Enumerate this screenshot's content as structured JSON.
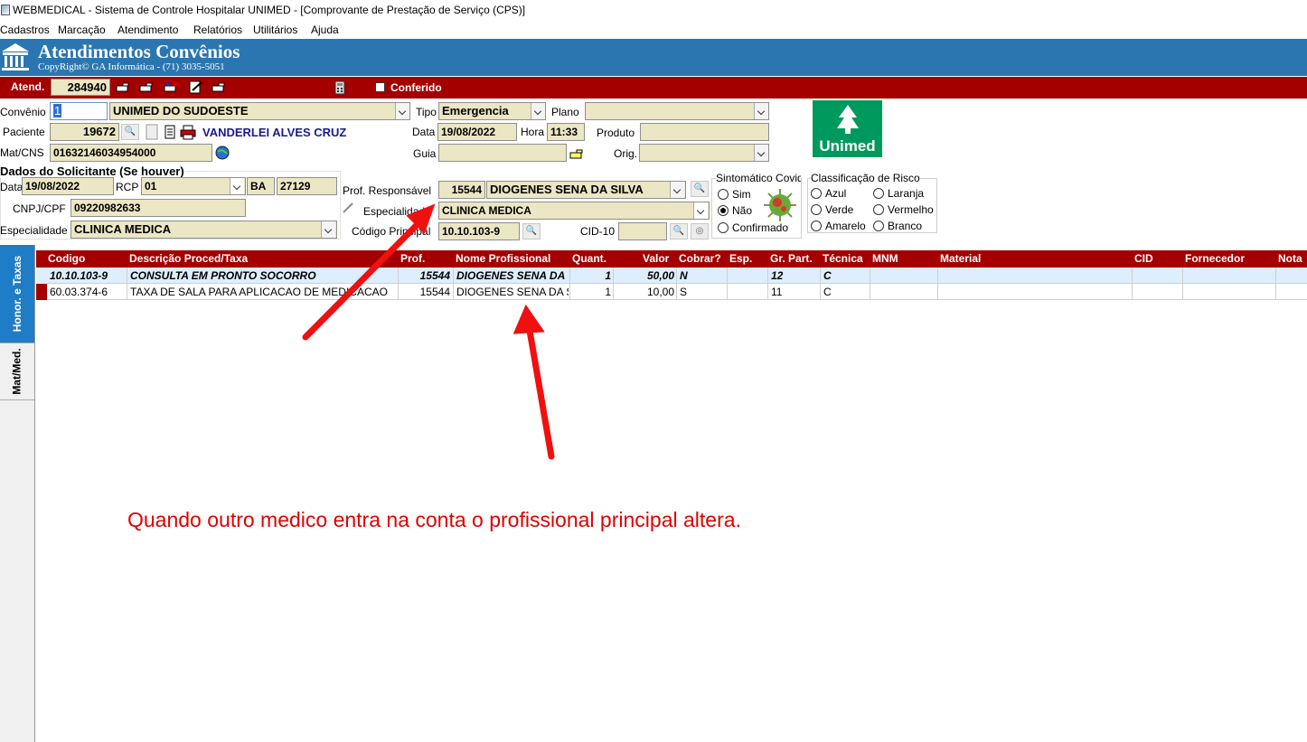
{
  "window": {
    "title": "WEBMEDICAL - Sistema de Controle Hospitalar UNIMED - [Comprovante de Prestação de Serviço  (CPS)]"
  },
  "menu": [
    "Cadastros",
    "Marcação",
    "Atendimento",
    "Relatórios",
    "Utilitários",
    "Ajuda"
  ],
  "banner": {
    "title": "Atendimentos Convênios",
    "copyright": "CopyRight© GA Informática - (71) 3035-5051"
  },
  "atend": {
    "label": "Atend.",
    "value": "284940",
    "conferido_label": "Conferido",
    "conferido_checked": false
  },
  "form": {
    "convenio_label": "Convênio",
    "convenio_code": "1",
    "convenio_name": "UNIMED DO SUDOESTE",
    "tipo_label": "Tipo",
    "tipo_value": "Emergencia",
    "plano_label": "Plano",
    "plano_value": "",
    "paciente_label": "Paciente",
    "paciente_code": "19672",
    "paciente_name": "VANDERLEI ALVES CRUZ",
    "data_label": "Data",
    "data_value": "19/08/2022",
    "hora_label": "Hora",
    "hora_value": "11:33",
    "produto_label": "Produto",
    "produto_value": "",
    "matcns_label": "Mat/CNS",
    "matcns_value": "01632146034954000",
    "guia_label": "Guia",
    "guia_value": "",
    "orig_label": "Orig.",
    "orig_value": ""
  },
  "solicitante": {
    "title": "Dados do Solicitante (Se houver)",
    "data_label": "Data",
    "data_value": "19/08/2022",
    "rcp_label": "RCP",
    "rcp_value": "01",
    "uf_value": "BA",
    "rcp_number": "27129",
    "cnpj_label": "CNPJ/CPF",
    "cnpj_value": "09220982633",
    "esp_label": "Especialidade",
    "esp_value": "CLINICA MEDICA"
  },
  "profissional": {
    "resp_label": "Prof. Responsável",
    "resp_code": "15544",
    "resp_name": "DIOGENES SENA DA SILVA",
    "esp_label": "Especialidade",
    "esp_value": "CLINICA MEDICA",
    "cod_label": "Código Principal",
    "cod_value": "10.10.103-9",
    "cid_label": "CID-10",
    "cid_value": ""
  },
  "covid": {
    "title": "Sintomático Covid",
    "options": [
      "Sim",
      "Não",
      "Confirmado"
    ],
    "selected": "Não"
  },
  "risco": {
    "title": "Classificação de Risco",
    "options_left": [
      "Azul",
      "Verde",
      "Amarelo"
    ],
    "options_right": [
      "Laranja",
      "Vermelho",
      "Branco"
    ]
  },
  "logo": {
    "text": "Unimed",
    "color": "#00995d"
  },
  "tabs": [
    "Honor. e Taxas",
    "Mat/Med."
  ],
  "grid": {
    "columns": [
      "Codigo",
      "Descrição Proced/Taxa",
      "Prof.",
      "Nome Profissional",
      "Quant.",
      "Valor",
      "Cobrar?",
      "Esp.",
      "Gr. Part.",
      "Técnica",
      "MNM",
      "Material",
      "CID",
      "Fornecedor",
      "Nota"
    ],
    "rows": [
      {
        "codigo": "10.10.103-9",
        "desc": "CONSULTA EM PRONTO SOCORRO",
        "prof": "15544",
        "nome": "DIOGENES SENA DA",
        "quant": "1",
        "valor": "50,00",
        "cobrar": "N",
        "esp": "",
        "grpart": "12",
        "tecnica": "C"
      },
      {
        "codigo": "60.03.374-6",
        "desc": "TAXA DE SALA PARA APLICACAO DE MEDICACAO",
        "prof": "15544",
        "nome": "DIOGENES SENA DA S",
        "quant": "1",
        "valor": "10,00",
        "cobrar": "S",
        "esp": "",
        "grpart": "11",
        "tecnica": "C"
      }
    ]
  },
  "annotation": "Quando outro medico entra na conta o profissional principal altera.",
  "colors": {
    "accent_red": "#a40000",
    "banner_blue": "#2b76b0",
    "field_bg": "#ebe6c4",
    "arrow_red": "#f01010"
  }
}
